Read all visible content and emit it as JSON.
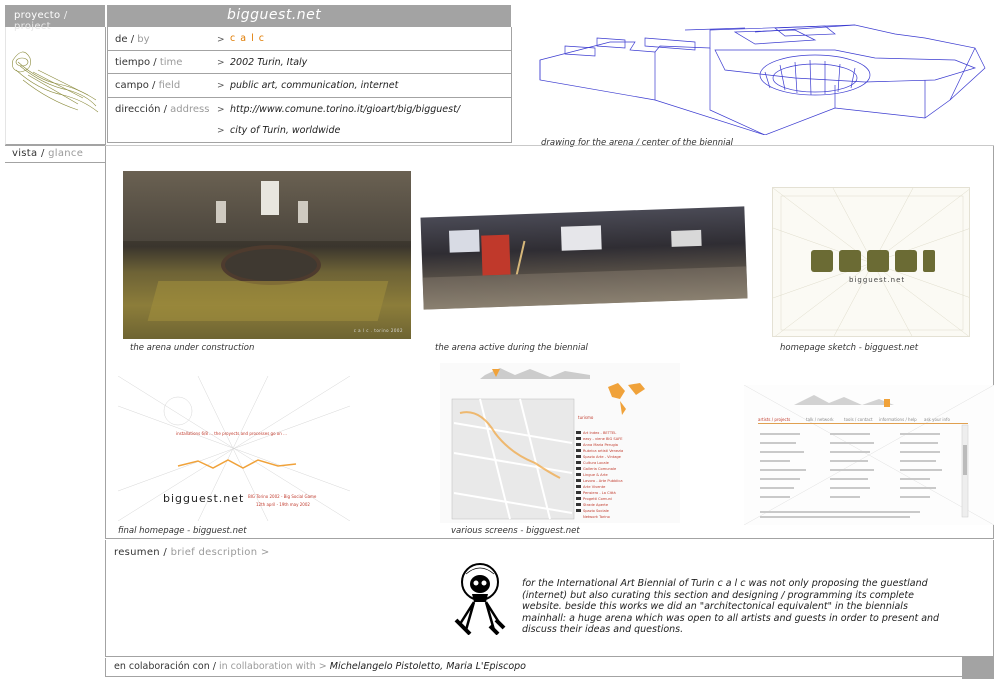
{
  "nav": {
    "project_es": "proyecto",
    "project_en": "project",
    "glance_es": "vista",
    "glance_en": "glance",
    "sep": "/"
  },
  "title": "bigguest.net",
  "info": {
    "by_es": "de",
    "by_en": "by",
    "by_val": "c a l c",
    "time_es": "tiempo",
    "time_en": "time",
    "time_val": "2002  Turin, Italy",
    "field_es": "campo",
    "field_en": "field",
    "field_val": "public art, communication, internet",
    "address_es": "dirección",
    "address_en": "address",
    "address_val1": "http://www.comune.torino.it/gioart/big/bigguest/",
    "address_val2": "city of Turin, worldwide",
    "gt": ">"
  },
  "captions": {
    "drawing": "drawing for the arena / center of the biennial",
    "arena_construction": "the arena under construction",
    "arena_active": "the arena active during the biennial",
    "homepage_sketch": "homepage sketch - bigguest.net",
    "final_homepage": "final homepage - bigguest.net",
    "various_screens": "various screens - bigguest.net"
  },
  "photo_text": {
    "calc_stamp": "c a l c . torino 2002",
    "sketch_logo": "bigguest.net",
    "final_logo": "bigguest.net",
    "final_red": "installations 6/8 ... the proyects and processes go on ...",
    "final_sub": "BIG Torino 2002 - Big Social Game",
    "final_date": "12th april - 19th may 2002",
    "screen_tag": "turismo",
    "links_header": "artists / projects",
    "links_tabs": [
      "talk / network",
      "tools / contact",
      "informations / help",
      "ask your info"
    ]
  },
  "list_items": [
    "Art Index - BETTEL",
    "easy - viene BIG SAFE",
    "Anna Maria Perugia",
    "Rubrica artisti Venezia",
    "Spazio Arte - Vintage",
    "Cultura Locale",
    "Galleria Comunale",
    "Lingue & Arte",
    "Lavoro - Arte Pubblica",
    "Arte Vivente",
    "Pensiero - La Città",
    "Progetti Comuni",
    "Strade Aperte",
    "Spazio Sociale",
    "Network Torino"
  ],
  "description": {
    "label_es": "resumen",
    "label_en": "brief description",
    "gt": ">",
    "text": "for the International Art Biennial of Turin  c a l c  was not only proposing the guestland (internet) but also curating this section and designing / programming its complete website. beside this works we did an \"architectonical equivalent\" in the biennials mainhall: a huge arena which was open to all artists and guests in order to present and discuss their ideas and questions."
  },
  "collab": {
    "label_es": "en colaboración con",
    "label_en": "in collaboration with",
    "gt": ">",
    "names": "Michelangelo Pistoletto, Maria L'Episcopo"
  },
  "colors": {
    "accent": "#e07b00",
    "bar": "#a3a3a3",
    "drawing_line": "#3b3bd0",
    "sketch": "#6b6b34"
  }
}
